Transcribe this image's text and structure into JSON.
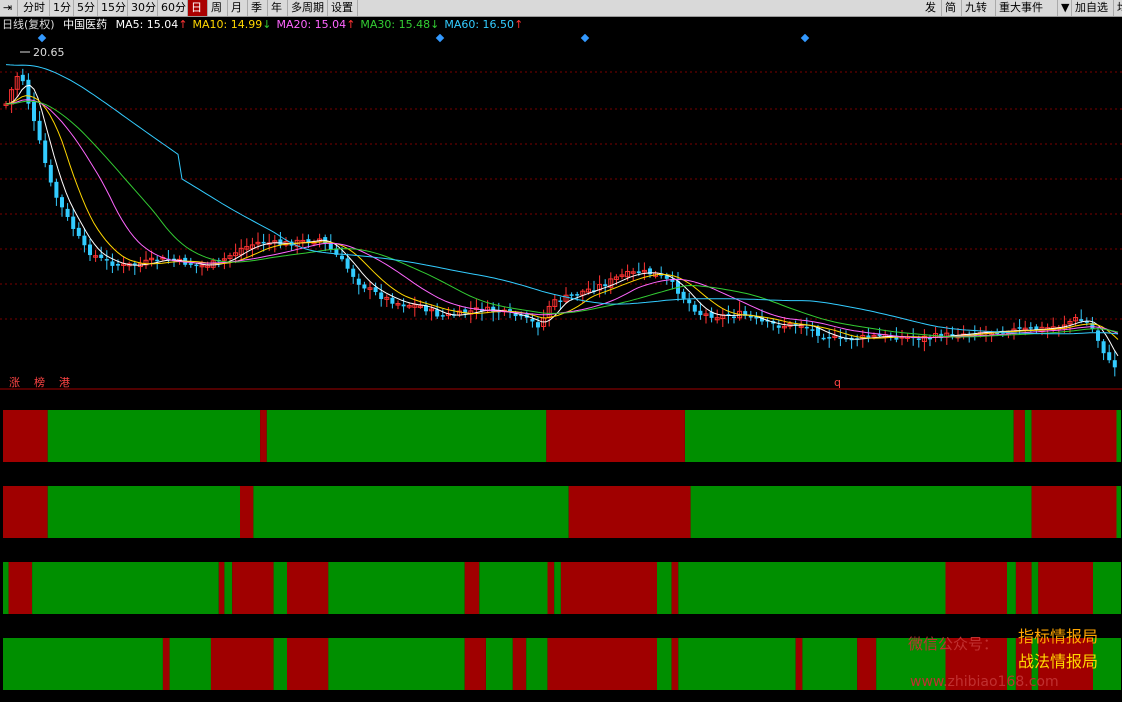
{
  "toolbar": {
    "left": [
      {
        "label": "分时",
        "active": false
      },
      {
        "label": "1分",
        "active": false
      },
      {
        "label": "5分",
        "active": false
      },
      {
        "label": "15分",
        "active": false
      },
      {
        "label": "30分",
        "active": false
      },
      {
        "label": "60分",
        "active": false
      },
      {
        "label": "日",
        "active": true
      },
      {
        "label": "周",
        "active": false
      },
      {
        "label": "月",
        "active": false
      },
      {
        "label": "季",
        "active": false
      },
      {
        "label": "年",
        "active": false
      },
      {
        "label": "多周期",
        "active": false
      },
      {
        "label": "设置",
        "active": false
      }
    ],
    "right": [
      "发",
      "简",
      "九转",
      "重大事件",
      "▼",
      "加自选",
      "均线"
    ]
  },
  "info": {
    "period": "日线(复权)",
    "stock": "中国医药",
    "ma": [
      {
        "label": "MA5: 15.04",
        "arrow": "↑",
        "color": "#ffffff"
      },
      {
        "label": "MA10: 14.99",
        "arrow": "↓",
        "color": "#ffd700"
      },
      {
        "label": "MA20: 15.04",
        "arrow": "↑",
        "color": "#ff66ff"
      },
      {
        "label": "MA30: 15.48",
        "arrow": "↓",
        "color": "#33cc33"
      },
      {
        "label": "MA60: 16.50",
        "arrow": "↑",
        "color": "#33ccff"
      }
    ]
  },
  "chart": {
    "max_price_label": "20.65",
    "bottom_labels": [
      "涨",
      "榜",
      "港"
    ],
    "marker_label": "q",
    "colors": {
      "up": "#ff3333",
      "down": "#33ccff",
      "grid": "#7a0000",
      "ma5": "#ffffff",
      "ma10": "#ffd700",
      "ma20": "#ff66ff",
      "ma30": "#33cc33",
      "ma60": "#33ccff"
    }
  },
  "bands": {
    "colors": {
      "red": "#a00000",
      "green": "#008f00"
    },
    "rows": [
      {
        "segments": [
          [
            "r",
            0.0,
            0.04
          ],
          [
            "g",
            0.04,
            0.23
          ],
          [
            "r",
            0.23,
            0.236
          ],
          [
            "g",
            0.236,
            0.486
          ],
          [
            "r",
            0.486,
            0.61
          ],
          [
            "g",
            0.61,
            0.904
          ],
          [
            "r",
            0.904,
            0.914
          ],
          [
            "g",
            0.914,
            0.92
          ],
          [
            "r",
            0.92,
            0.996
          ],
          [
            "g",
            0.996,
            1.0
          ]
        ]
      },
      {
        "segments": [
          [
            "r",
            0.0,
            0.04
          ],
          [
            "g",
            0.04,
            0.212
          ],
          [
            "r",
            0.212,
            0.224
          ],
          [
            "g",
            0.224,
            0.506
          ],
          [
            "r",
            0.506,
            0.615
          ],
          [
            "g",
            0.615,
            0.92
          ],
          [
            "r",
            0.92,
            0.996
          ],
          [
            "g",
            0.996,
            1.0
          ]
        ]
      },
      {
        "segments": [
          [
            "g",
            0.0,
            0.005
          ],
          [
            "r",
            0.005,
            0.026
          ],
          [
            "g",
            0.026,
            0.193
          ],
          [
            "r",
            0.193,
            0.198
          ],
          [
            "g",
            0.198,
            0.205
          ],
          [
            "r",
            0.205,
            0.242
          ],
          [
            "g",
            0.242,
            0.254
          ],
          [
            "r",
            0.254,
            0.291
          ],
          [
            "g",
            0.291,
            0.413
          ],
          [
            "r",
            0.413,
            0.426
          ],
          [
            "g",
            0.426,
            0.487
          ],
          [
            "r",
            0.487,
            0.493
          ],
          [
            "g",
            0.493,
            0.499
          ],
          [
            "r",
            0.499,
            0.585
          ],
          [
            "g",
            0.585,
            0.598
          ],
          [
            "r",
            0.598,
            0.604
          ],
          [
            "g",
            0.604,
            0.843
          ],
          [
            "r",
            0.843,
            0.898
          ],
          [
            "g",
            0.898,
            0.906
          ],
          [
            "r",
            0.906,
            0.92
          ],
          [
            "g",
            0.92,
            0.926
          ],
          [
            "r",
            0.926,
            0.975
          ],
          [
            "g",
            0.975,
            1.0
          ]
        ]
      },
      {
        "segments": [
          [
            "g",
            0.0,
            0.143
          ],
          [
            "r",
            0.143,
            0.149
          ],
          [
            "g",
            0.149,
            0.186
          ],
          [
            "r",
            0.186,
            0.242
          ],
          [
            "g",
            0.242,
            0.254
          ],
          [
            "r",
            0.254,
            0.291
          ],
          [
            "g",
            0.291,
            0.413
          ],
          [
            "r",
            0.413,
            0.432
          ],
          [
            "g",
            0.432,
            0.456
          ],
          [
            "r",
            0.456,
            0.468
          ],
          [
            "g",
            0.468,
            0.487
          ],
          [
            "r",
            0.487,
            0.585
          ],
          [
            "g",
            0.585,
            0.598
          ],
          [
            "r",
            0.598,
            0.604
          ],
          [
            "g",
            0.604,
            0.709
          ],
          [
            "r",
            0.709,
            0.715
          ],
          [
            "g",
            0.715,
            0.764
          ],
          [
            "r",
            0.764,
            0.781
          ],
          [
            "g",
            0.781,
            0.843
          ],
          [
            "r",
            0.843,
            0.898
          ],
          [
            "g",
            0.898,
            0.906
          ],
          [
            "r",
            0.906,
            0.92
          ],
          [
            "g",
            0.92,
            0.926
          ],
          [
            "r",
            0.926,
            0.975
          ],
          [
            "g",
            0.975,
            1.0
          ]
        ]
      }
    ]
  },
  "watermark": {
    "wechat": "微信公众号：",
    "line1": "指标情报局",
    "line2": "战法情报局",
    "url": "www.zhibiao168.com"
  }
}
